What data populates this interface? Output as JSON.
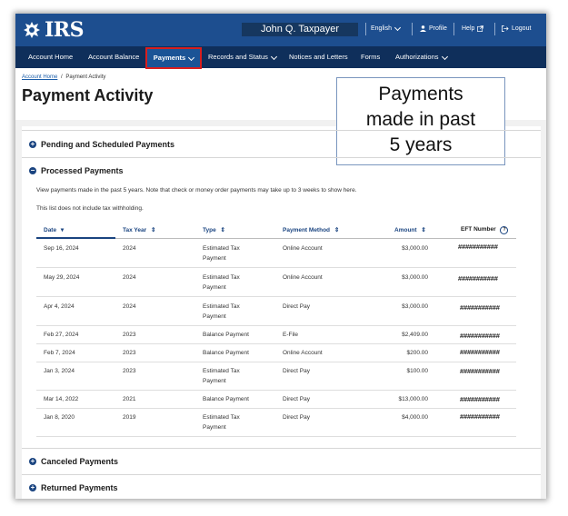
{
  "header": {
    "logo_text": "IRS",
    "user_name": "John Q. Taxpayer",
    "language": "English",
    "profile": "Profile",
    "help": "Help",
    "logout": "Logout"
  },
  "nav": {
    "items": [
      "Account Home",
      "Account Balance",
      "Payments",
      "Records and Status",
      "Notices and Letters",
      "Forms",
      "Authorizations"
    ]
  },
  "breadcrumb": {
    "home": "Account Home",
    "sep": "/",
    "current": "Payment Activity"
  },
  "page_title": "Payment Activity",
  "callout": {
    "line1": "Payments",
    "line2": "made in past",
    "line3": "5 years"
  },
  "sections": {
    "pending": "Pending and Scheduled Payments",
    "processed": "Processed Payments",
    "canceled": "Canceled Payments",
    "returned": "Returned Payments"
  },
  "notes": {
    "info": "View payments made in the past 5 years. Note that check or money order payments may take up to 3 weeks to show here.",
    "withholding": "This list does not include tax withholding."
  },
  "table": {
    "headers": {
      "date": "Date",
      "tax_year": "Tax Year",
      "type": "Type",
      "method": "Payment Method",
      "amount": "Amount",
      "eft": "EFT Number"
    },
    "rows": [
      {
        "date": "Sep 16, 2024",
        "tax_year": "2024",
        "type1": "Estimated Tax",
        "type2": "Payment",
        "method": "Online Account",
        "amount": "$3,000.00",
        "eft": "###########"
      },
      {
        "date": "May 29, 2024",
        "tax_year": "2024",
        "type1": "Estimated Tax",
        "type2": "Payment",
        "method": "Online Account",
        "amount": "$3,000.00",
        "eft": "###########"
      },
      {
        "date": "Apr 4, 2024",
        "tax_year": "2024",
        "type1": "Estimated Tax",
        "type2": "Payment",
        "method": "Direct Pay",
        "amount": "$3,000.00",
        "eft": "###########"
      },
      {
        "date": "Feb 27, 2024",
        "tax_year": "2023",
        "type1": "Balance Payment",
        "type2": "",
        "method": "E-File",
        "amount": "$2,409.00",
        "eft": "###########"
      },
      {
        "date": "Feb 7, 2024",
        "tax_year": "2023",
        "type1": "Balance Payment",
        "type2": "",
        "method": "Online Account",
        "amount": "$200.00",
        "eft": "###########"
      },
      {
        "date": "Jan 3, 2024",
        "tax_year": "2023",
        "type1": "Estimated Tax",
        "type2": "Payment",
        "method": "Direct Pay",
        "amount": "$100.00",
        "eft": "###########"
      },
      {
        "date": "Mar 14, 2022",
        "tax_year": "2021",
        "type1": "Balance Payment",
        "type2": "",
        "method": "Direct Pay",
        "amount": "$13,000.00",
        "eft": "###########"
      },
      {
        "date": "Jan 8, 2020",
        "tax_year": "2019",
        "type1": "Estimated Tax",
        "type2": "Payment",
        "method": "Direct Pay",
        "amount": "$4,000.00",
        "eft": "###########"
      }
    ]
  },
  "colors": {
    "header": "#1d4e8f",
    "nav": "#0f2f5b",
    "active_outline": "#d81e1e",
    "link": "#1a4480"
  }
}
